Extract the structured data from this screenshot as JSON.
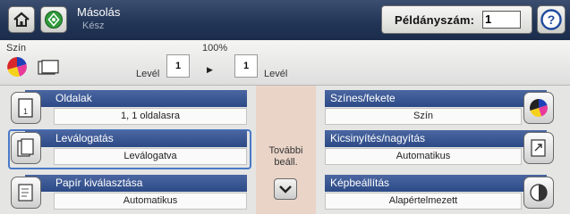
{
  "header": {
    "app_title": "Másolás",
    "status": "Kész",
    "copies_label": "Példányszám:",
    "copies_value": "1",
    "home_icon": "home-icon",
    "start_icon": "start-copy-icon",
    "help_icon": "help-icon"
  },
  "preview": {
    "color_label": "Szín",
    "zoom_label": "100%",
    "source_paper": "Levél",
    "source_tray": "1",
    "dest_tray": "1",
    "dest_paper": "Levél"
  },
  "settings": {
    "left": [
      {
        "title": "Oldalak",
        "value": "1, 1 oldalasra",
        "icon": "sides-icon"
      },
      {
        "title": "Leválogatás",
        "value": "Leválogatva",
        "icon": "collate-icon"
      },
      {
        "title": "Papír kiválasztása",
        "value": "Automatikus",
        "icon": "paper-select-icon"
      }
    ],
    "right": [
      {
        "title": "Színes/fekete",
        "value": "Szín",
        "icon": "color-black-icon"
      },
      {
        "title": "Kicsinyítés/nagyítás",
        "value": "Automatikus",
        "icon": "reduce-enlarge-icon"
      },
      {
        "title": "Képbeállítás",
        "value": "Alapértelmezett",
        "icon": "image-adjust-icon"
      }
    ],
    "more_options": "További beáll."
  },
  "colors": {
    "header_bg": "#233657",
    "tile_bar": "#3b5894",
    "center_col": "#e9d4c7",
    "selection": "#4a79c8"
  }
}
